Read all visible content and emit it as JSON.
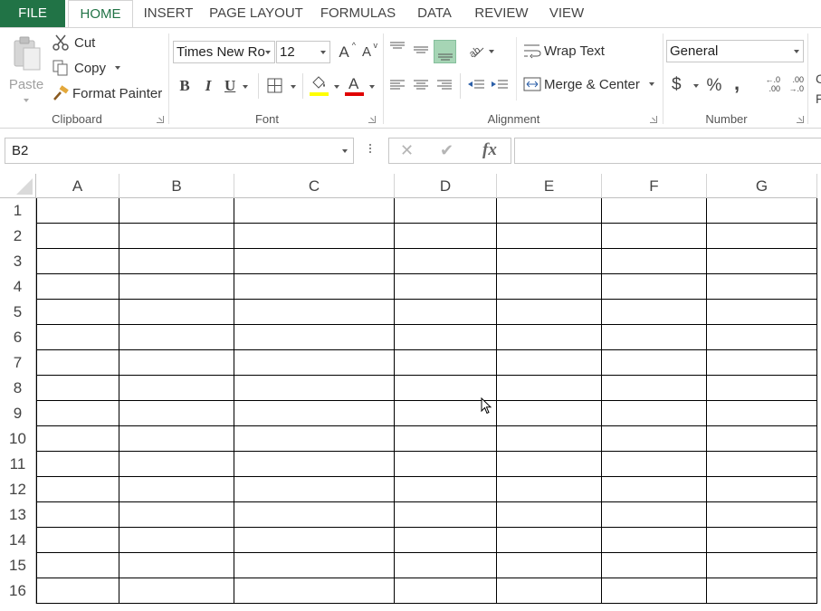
{
  "tabs": [
    "FILE",
    "HOME",
    "INSERT",
    "PAGE LAYOUT",
    "FORMULAS",
    "DATA",
    "REVIEW",
    "VIEW"
  ],
  "clipboard": {
    "paste": "Paste",
    "cut": "Cut",
    "copy": "Copy",
    "format_painter": "Format Painter",
    "label": "Clipboard"
  },
  "font": {
    "name": "Times New Ro",
    "size": "12",
    "bold": "B",
    "italic": "I",
    "underline": "U",
    "grow": "A",
    "shrink": "A",
    "color_letter": "A",
    "label": "Font",
    "highlight_color": "#ffff00",
    "font_color": "#ff0000"
  },
  "alignment": {
    "wrap_text": "Wrap Text",
    "merge_center": "Merge & Center",
    "label": "Alignment"
  },
  "number": {
    "format": "General",
    "currency": "$",
    "percent": "%",
    "comma": ",",
    "increase_decimal_top": "←.0",
    "increase_decimal_bottom": ".00",
    "decrease_decimal_top": ".00",
    "decrease_decimal_bottom": "→.0",
    "label": "Number",
    "cutoff_letters": [
      "C",
      "F"
    ]
  },
  "formula_bar": {
    "name_box": "B2",
    "fx": "fx",
    "cancel": "✕",
    "enter": "✔",
    "formula": ""
  },
  "grid": {
    "columns": [
      "A",
      "B",
      "C",
      "D",
      "E",
      "F",
      "G"
    ],
    "rows": [
      "1",
      "2",
      "3",
      "4",
      "5",
      "6",
      "7",
      "8",
      "9",
      "10",
      "11",
      "12",
      "13",
      "14",
      "15",
      "16"
    ]
  },
  "colors": {
    "accent": "#217346",
    "selected_align_bg": "#a6d5b5"
  }
}
